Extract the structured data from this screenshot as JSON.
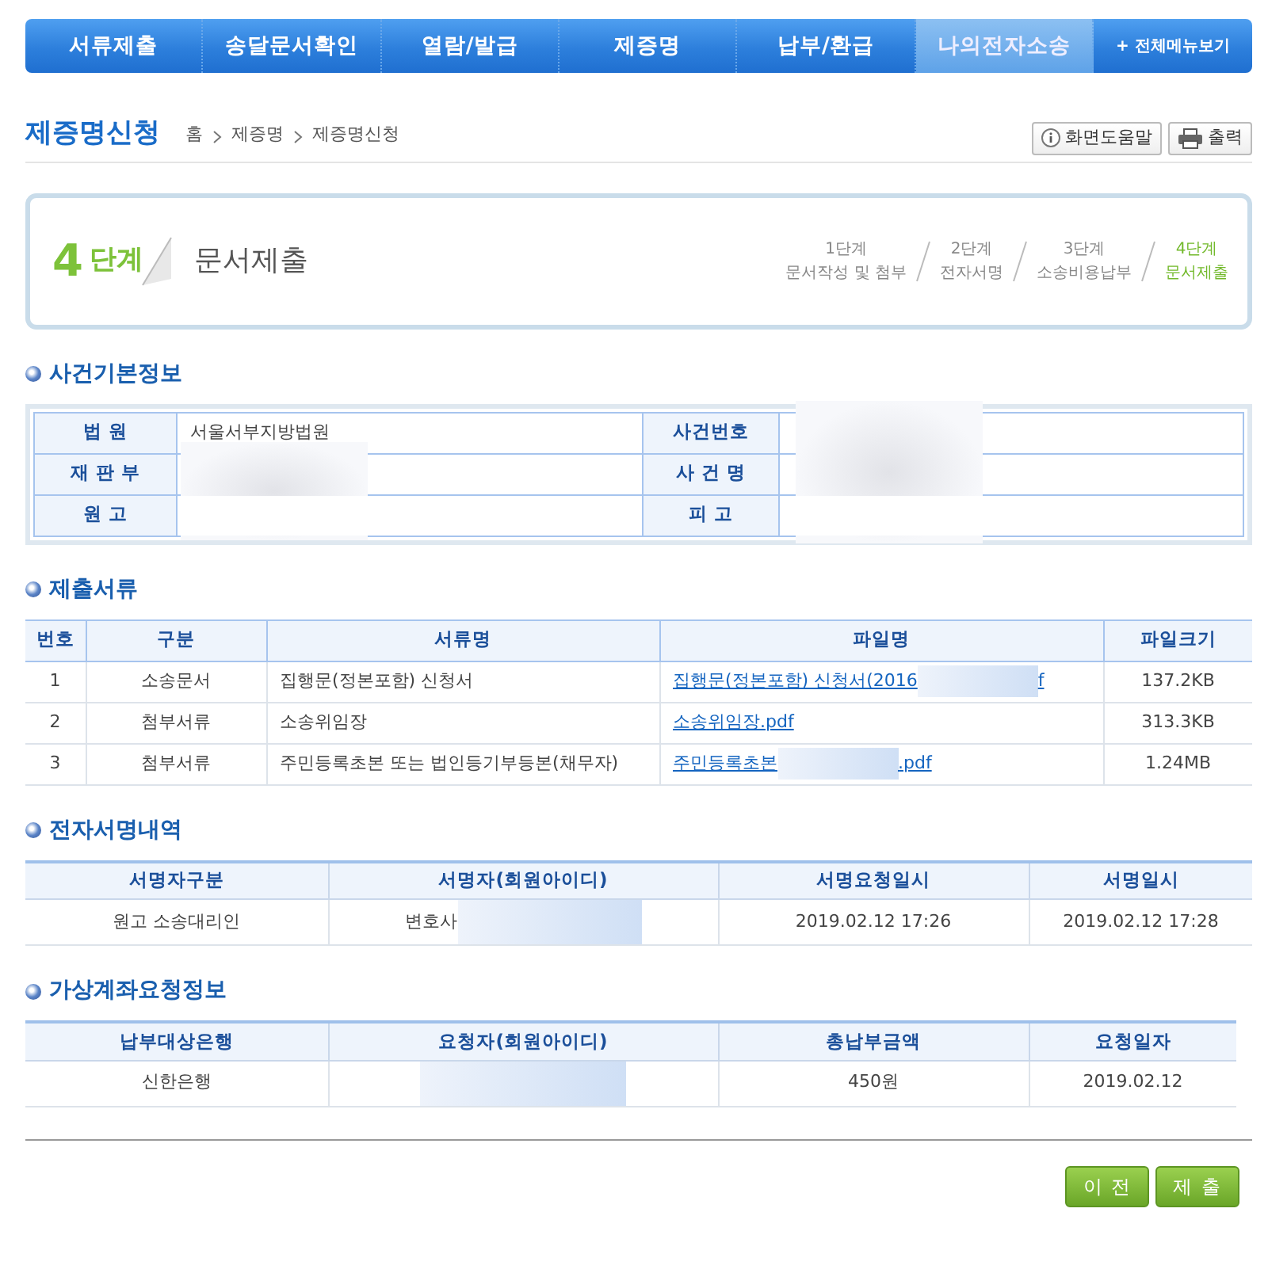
{
  "nav": {
    "items": [
      {
        "label": "서류제출",
        "selected": false
      },
      {
        "label": "송달문서확인",
        "selected": false
      },
      {
        "label": "열람/발급",
        "selected": false
      },
      {
        "label": "제증명",
        "selected": false
      },
      {
        "label": "납부/환급",
        "selected": false
      },
      {
        "label": "나의전자소송",
        "selected": true
      }
    ],
    "all_menu": "+ 전체메뉴보기"
  },
  "page_title": "제증명신청",
  "breadcrumb": [
    "홈",
    "제증명",
    "제증명신청"
  ],
  "tools": [
    {
      "kind": "help",
      "label": "화면도움말"
    },
    {
      "kind": "print",
      "label": "출력"
    }
  ],
  "stage": {
    "number": "4",
    "unit": "단계",
    "title": "문서제출",
    "steps": [
      {
        "step": "1단계",
        "label": "문서작성 및 첨부",
        "selected": false
      },
      {
        "step": "2단계",
        "label": "전자서명",
        "selected": false
      },
      {
        "step": "3단계",
        "label": "소송비용납부",
        "selected": false
      },
      {
        "step": "4단계",
        "label": "문서제출",
        "selected": true
      }
    ]
  },
  "case_info": {
    "title": "사건기본정보",
    "rows": [
      {
        "label": "법 원",
        "value": "서울서부지방법원",
        "label2": "사건번호"
      },
      {
        "label": "재 판 부",
        "value": "",
        "label2": "사 건 명"
      },
      {
        "label": "원 고",
        "value": "",
        "label2": "피 고"
      }
    ]
  },
  "documents": {
    "title": "제출서류",
    "columns": [
      "번호",
      "구분",
      "서류명",
      "파일명",
      "파일크기"
    ],
    "rows": [
      {
        "no": "1",
        "type": "소송문서",
        "name": "집행문(정본포함) 신청서",
        "file": [
          "집행문(정본포함) 신청서(2016",
          "f"
        ],
        "size": "137.2KB"
      },
      {
        "no": "2",
        "type": "첨부서류",
        "name": "소송위임장",
        "file": [
          "소송위임장.pdf"
        ],
        "size": "313.3KB"
      },
      {
        "no": "3",
        "type": "첨부서류",
        "name": "주민등록초본 또는 법인등기부등본(채무자)",
        "file": [
          "주민등록초본",
          ".pdf"
        ],
        "size": "1.24MB"
      }
    ]
  },
  "signatures": {
    "title": "전자서명내역",
    "columns": [
      "서명자구분",
      "서명자(회원아이디)",
      "서명요청일시",
      "서명일시"
    ],
    "rows": [
      [
        "원고 소송대리인",
        "변호사",
        "2019.02.12 17:26",
        "2019.02.12 17:28"
      ]
    ]
  },
  "virtual_account": {
    "title": "가상계좌요청정보",
    "columns": [
      "납부대상은행",
      "요청자(회원아이디)",
      "총납부금액",
      "요청일자"
    ],
    "rows": [
      [
        "신한은행",
        "",
        "450원",
        "2019.02.12"
      ]
    ]
  },
  "buttons": [
    "이 전",
    "제 출"
  ]
}
